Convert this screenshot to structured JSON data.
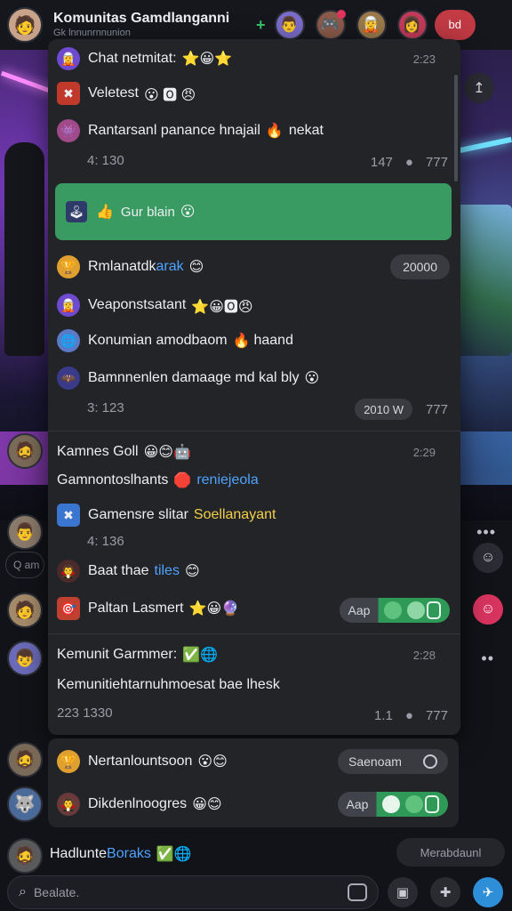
{
  "header": {
    "title": "Komunitas Gamdlanganni",
    "subtitle": "Gk lnnunrnnunion",
    "button_label": "bd"
  },
  "panel": {
    "rows": [
      {
        "text": "Chat netmitat:",
        "emoji": "⭐😀⭐",
        "meta": "2:23"
      },
      {
        "text": "Veletest",
        "emoji": "😮 🅾 😠"
      },
      {
        "text": "Rantarsanl panance hnajail",
        "emoji": "🔥",
        "extra": "nekat"
      },
      {
        "sub": "4: 130",
        "counts": [
          "147",
          "777"
        ]
      },
      {
        "green_text": "Gur blain"
      },
      {
        "text": "Rmlanatdk",
        "highlight": "arak",
        "emoji": "😊",
        "pill": "20000"
      },
      {
        "text": "Veaponstsatant",
        "emoji": "⭐😀🅾😠"
      },
      {
        "text": "Konumian amodbaom",
        "emoji": "🔥",
        "extra": "haand"
      },
      {
        "text": "Bamnnenlen damaage md kal bly",
        "emoji": "😮"
      },
      {
        "sub": "3: 123",
        "pill": "2010 W",
        "counts": [
          "777"
        ]
      },
      {
        "text": "Kamnes Goll",
        "emoji": "😀😊🤖",
        "meta": "2:29"
      },
      {
        "text": "Gamnontoslhants",
        "emoji": "🛑",
        "extra": "reniejeola"
      },
      {
        "text": "Gamensre slitar",
        "extra": "Soellanayant"
      },
      {
        "sub": "4: 136"
      },
      {
        "text": "Baat thae",
        "highlight": "tiles",
        "emoji": "😊"
      },
      {
        "text": "Paltan Lasmert",
        "emoji": "⭐😀🔮",
        "pill": "Aap"
      },
      {
        "text": "Kemunit Garmmer:",
        "emoji": "✅🌐",
        "meta": "2:28"
      },
      {
        "text": "Kemunitiehtarnuhmoesat bae lhesk"
      },
      {
        "sub": "223 1330",
        "counts": [
          "1.1",
          "777"
        ]
      }
    ]
  },
  "bottom_card": {
    "rows": [
      {
        "text": "Nertanlountsoon",
        "emoji": "😮😊",
        "pill": "Saenoam"
      },
      {
        "text": "Dikdenlnoogres",
        "emoji": "😀😊",
        "pill": "Aap"
      }
    ]
  },
  "footer": {
    "name": "Hadlunte",
    "name_highlight": "Boraks",
    "emoji": "✅🌐",
    "ghost_button": "Merabdaunl",
    "search_placeholder": "Bealate."
  },
  "mini_search": "Q am"
}
